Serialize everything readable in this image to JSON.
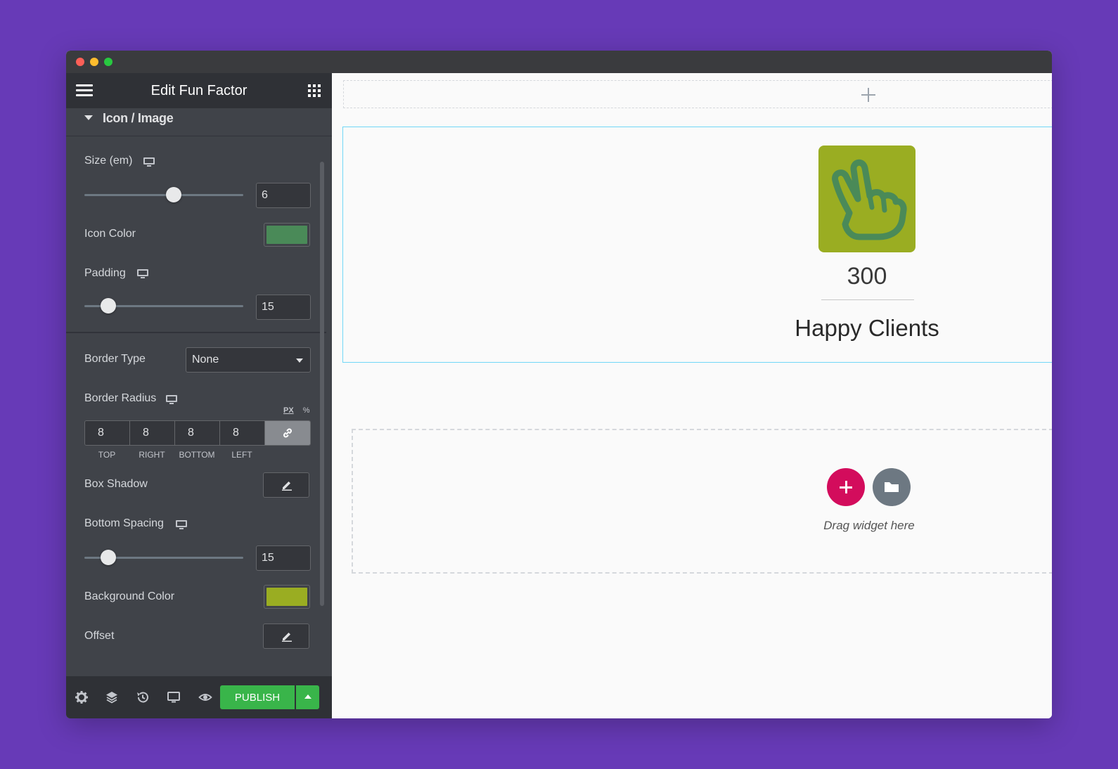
{
  "panel": {
    "title": "Edit Fun Factor",
    "section_label": "Icon / Image"
  },
  "controls": {
    "size_label": "Size (em)",
    "size_value": "6",
    "size_fraction": 0.56,
    "icon_color_label": "Icon Color",
    "icon_color": "#4a8a58",
    "padding_label": "Padding",
    "padding_value": "15",
    "padding_fraction": 0.15,
    "border_type_label": "Border Type",
    "border_type_value": "None",
    "border_radius_label": "Border Radius",
    "unit_px": "PX",
    "unit_pct": "%",
    "radius": {
      "top": "8",
      "right": "8",
      "bottom": "8",
      "left": "8",
      "top_label": "TOP",
      "right_label": "RIGHT",
      "bottom_label": "BOTTOM",
      "left_label": "LEFT"
    },
    "box_shadow_label": "Box Shadow",
    "bottom_spacing_label": "Bottom Spacing",
    "bottom_spacing_value": "15",
    "bottom_spacing_fraction": 0.15,
    "background_color_label": "Background Color",
    "background_color": "#9aad22",
    "offset_label": "Offset"
  },
  "footer": {
    "publish_label": "PUBLISH",
    "icons": [
      "gear-icon",
      "layers-icon",
      "history-icon",
      "responsive-icon",
      "eye-icon"
    ]
  },
  "canvas": {
    "fun_factor_number": "300",
    "fun_factor_title": "Happy Clients",
    "drag_hint": "Drag widget here",
    "icon": "hand-peace-icon"
  },
  "colors": {
    "accent_publish": "#39b54a",
    "add_button": "#d30c5c",
    "section_outline": "#71d7f7"
  }
}
